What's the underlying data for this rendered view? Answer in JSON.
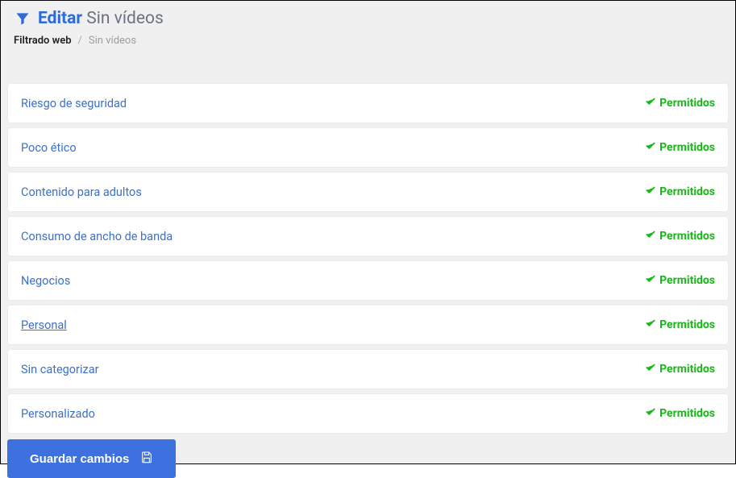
{
  "header": {
    "edit_label": "Editar",
    "title_suffix": "Sin vídeos"
  },
  "breadcrumb": {
    "root": "Filtrado web",
    "sep": "/",
    "current": "Sin vídeos"
  },
  "status_label": "Permitidos",
  "categories": [
    {
      "label": "Riesgo de seguridad",
      "status": "Permitidos",
      "hovered": false
    },
    {
      "label": "Poco ético",
      "status": "Permitidos",
      "hovered": false
    },
    {
      "label": "Contenido para adultos",
      "status": "Permitidos",
      "hovered": false
    },
    {
      "label": "Consumo de ancho de banda",
      "status": "Permitidos",
      "hovered": false
    },
    {
      "label": "Negocios",
      "status": "Permitidos",
      "hovered": false
    },
    {
      "label": "Personal",
      "status": "Permitidos",
      "hovered": true
    },
    {
      "label": "Sin categorizar",
      "status": "Permitidos",
      "hovered": false
    },
    {
      "label": "Personalizado",
      "status": "Permitidos",
      "hovered": false
    }
  ],
  "save_button_label": "Guardar cambios"
}
